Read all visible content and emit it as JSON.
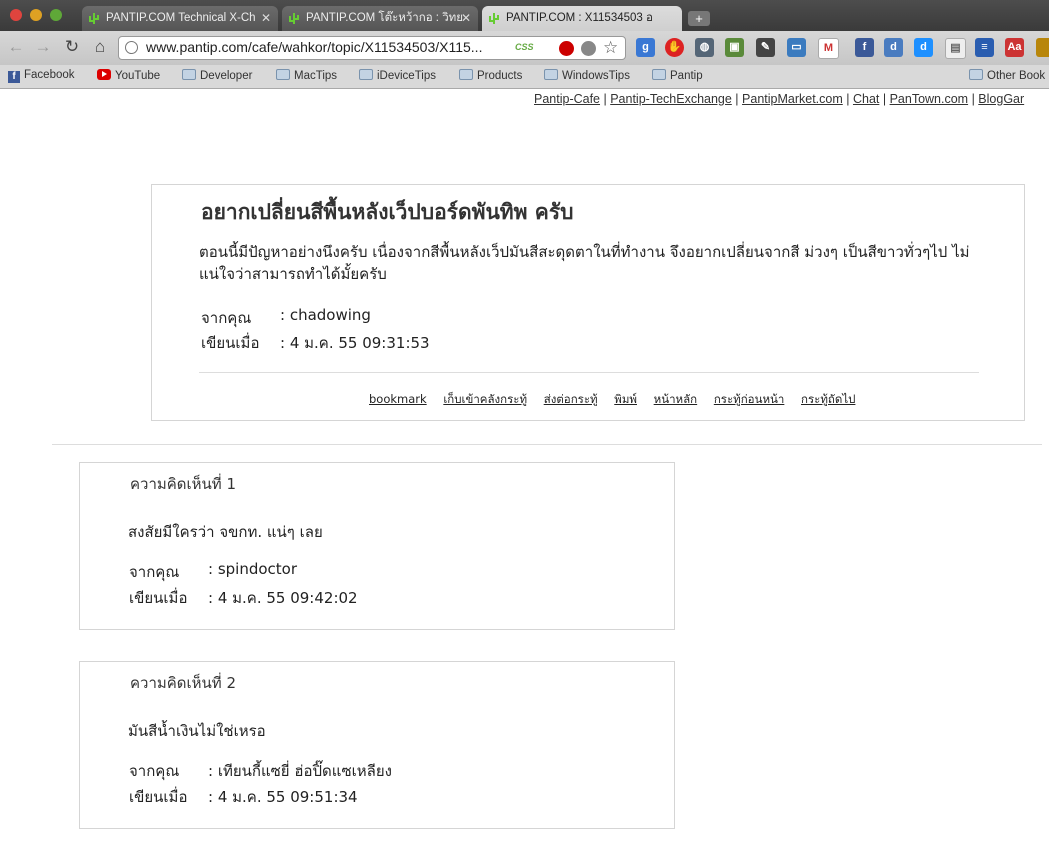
{
  "browser": {
    "tabs": [
      {
        "title": "PANTIP.COM Technical X-Ch",
        "active": false
      },
      {
        "title": "PANTIP.COM โต๊ะหว้ากอ : วิทย",
        "active": false
      },
      {
        "title": "PANTIP.COM : X11534503 อ",
        "active": true
      }
    ],
    "new_tab_label": "+",
    "url": "www.pantip.com/cafe/wahkor/topic/X11534503/X115...",
    "css_badge": "CSS"
  },
  "bookmarks": [
    {
      "label": "Facebook",
      "icon": "facebook-icon"
    },
    {
      "label": "YouTube",
      "icon": "youtube-icon"
    },
    {
      "label": "Developer",
      "icon": "folder-icon"
    },
    {
      "label": "MacTips",
      "icon": "folder-icon"
    },
    {
      "label": "iDeviceTips",
      "icon": "folder-icon"
    },
    {
      "label": "Products",
      "icon": "folder-icon"
    },
    {
      "label": "WindowsTips",
      "icon": "folder-icon"
    },
    {
      "label": "Pantip",
      "icon": "folder-icon"
    }
  ],
  "other_bookmarks": "Other Book",
  "top_links": [
    "Pantip-Cafe",
    "Pantip-TechExchange",
    "PantipMarket.com",
    "Chat",
    "PanTown.com",
    "BlogGar"
  ],
  "topic": {
    "title": "อยากเปลี่ยนสีพื้นหลังเว็ปบอร์ดพันทิพ ครับ",
    "body": "ตอนนี้มีปัญหาอย่างนึงครับ เนื่องจากสีพื้นหลังเว็ปมันสีสะดุดตาในที่ทำงาน จึงอยากเปลี่ยนจากสี ม่วงๆ เป็นสีขาวทั่วๆไป ไม่แน่ใจว่าสามารถทำได้มั้ยครับ",
    "from_label": "จากคุณ",
    "from_value": ": chadowing",
    "date_label": "เขียนเมื่อ",
    "date_value": ": 4 ม.ค. 55 09:31:53",
    "actions": [
      "bookmark",
      "เก็บเข้าคลังกระทู้",
      "ส่งต่อกระทู้",
      "พิมพ์",
      "หน้าหลัก",
      "กระทู้ก่อนหน้า",
      "กระทู้ถัดไป"
    ]
  },
  "comments": [
    {
      "heading": "ความคิดเห็นที่ 1",
      "body": "สงสัยมีใครว่า จขกท. แน่ๆ เลย",
      "from_label": "จากคุณ",
      "from_value": ": spindoctor",
      "date_label": "เขียนเมื่อ",
      "date_value": ": 4 ม.ค. 55 09:42:02"
    },
    {
      "heading": "ความคิดเห็นที่ 2",
      "body": "มันสีน้ำเงินไม่ใช่เหรอ",
      "from_label": "จากคุณ",
      "from_value": ": เทียนกี้แซยี่ ฮ่อปิ๊ดแซเหลียง",
      "date_label": "เขียนเมื่อ",
      "date_value": ": 4 ม.ค. 55 09:51:34"
    }
  ]
}
